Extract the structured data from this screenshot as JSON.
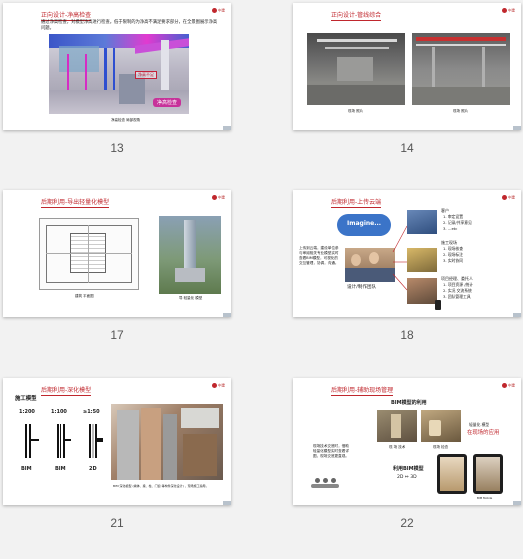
{
  "slides": [
    {
      "number": "13",
      "title": "正向设计-净高检查",
      "body": "通过净高检查，对模型净高进行检查。低于限制的为净高不满足要求部分，在全景图展示净高问题。",
      "overlay_label": "净高不足",
      "stamp": "净高检查",
      "caption": "净高检查 局部视角"
    },
    {
      "number": "14",
      "title": "正向设计-管线综合",
      "caption_left": "现场 照片",
      "caption_right": "现场 照片"
    },
    {
      "number": "17",
      "title": "后期利用-导出轻量化模型",
      "caption_left": "建筑 平面图",
      "caption_right": "导 轻量化 模型"
    },
    {
      "number": "18",
      "title": "后期利用-上传云端",
      "cloud": "Imagine...",
      "left_text": "上传到云端，建设单位参与审阅相关专业模型实时查看BIM模型，可视化的交互管理，协调，沟通。",
      "team_label": "设计/制作团队",
      "group1_title": "客户",
      "group1_items": [
        "1. 审定设置",
        "2. 记录/共享意见",
        "3. ...etc"
      ],
      "group2_title": "施工现场",
      "group2_items": [
        "1. 现场核查",
        "2. 现场标注",
        "3. 实时协同"
      ],
      "group3_title": "项目经理、委托人",
      "group3_items": [
        "1. 项目资源 /统计",
        "2. 实况 交流系统",
        "3. 团队管理工具"
      ]
    },
    {
      "number": "21",
      "title": "后期利用-深化模型",
      "subtitle": "施工模型",
      "scale1": "1:200",
      "scale2": "1:100",
      "scale3": "≥1:50",
      "label1": "BIM",
      "label2": "BIM",
      "label3": "2D",
      "caption": "BIM 深化模型 (墙体、梁、柱、门窗 等构件深化设计) ，现场施工指导。"
    },
    {
      "number": "22",
      "title": "后期利用-辅助现场管理",
      "heading": "BIM模型的利用",
      "left_text": "现场技术交底时，借助轻量化模型实时查看详图，现场交底更直观。",
      "caption_left": "现 场 技术",
      "caption_right": "现场 检查",
      "right_top": "轻量化 模型",
      "right_red": "在现场的应用",
      "lightweight": "利用BIM模型",
      "dims": "2D ⇔ 3D",
      "device_label": "BIM Mobile"
    }
  ],
  "logo_text": "中建"
}
